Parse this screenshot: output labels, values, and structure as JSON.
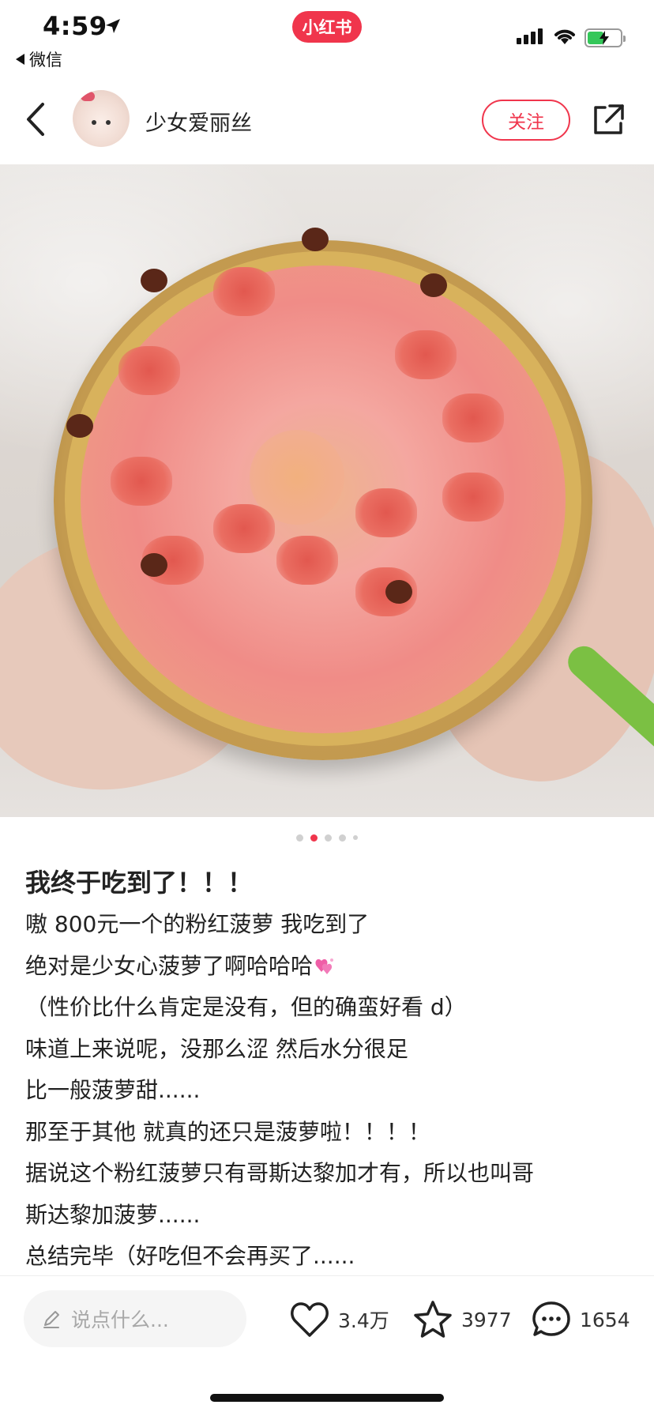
{
  "status_bar": {
    "time": "4:59",
    "back_app": "微信",
    "brand": "小红书",
    "battery_level": 0.5,
    "battery_color": "#34c759",
    "icons": [
      "location-arrow-icon",
      "signal-icon",
      "wifi-icon",
      "battery-icon"
    ]
  },
  "header": {
    "username": "少女爱丽丝",
    "follow_label": "关注",
    "icons": [
      "back-icon",
      "share-icon"
    ]
  },
  "carousel": {
    "image_count": 5,
    "active_index": 1
  },
  "post": {
    "title": "我终于吃到了！！！",
    "lines": [
      "嗷 800元一个的粉红菠萝 我吃到了",
      "绝对是少女心菠萝了啊哈哈哈",
      "（性价比什么肯定是没有，但的确蛮好看 d）",
      "味道上来说呢，没那么涩 然后水分很足",
      "比一般菠萝甜......",
      "那至于其他 就真的还只是菠萝啦！！！！",
      "据说这个粉红菠萝只有哥斯达黎加才有，所以也叫哥",
      "斯达黎加菠萝......",
      "总结完毕（好吃但不会再买了......"
    ],
    "emoji": "heart-emoji-icon"
  },
  "bottom_bar": {
    "comment_placeholder": "说点什么...",
    "like_count": "3.4万",
    "collect_count": "3977",
    "comment_count": "1654",
    "icons": [
      "pencil-icon",
      "heart-icon",
      "star-icon",
      "comment-bubble-icon"
    ]
  },
  "colors": {
    "accent": "#f0354c",
    "text": "#222222",
    "placeholder": "#a8a8a8"
  }
}
